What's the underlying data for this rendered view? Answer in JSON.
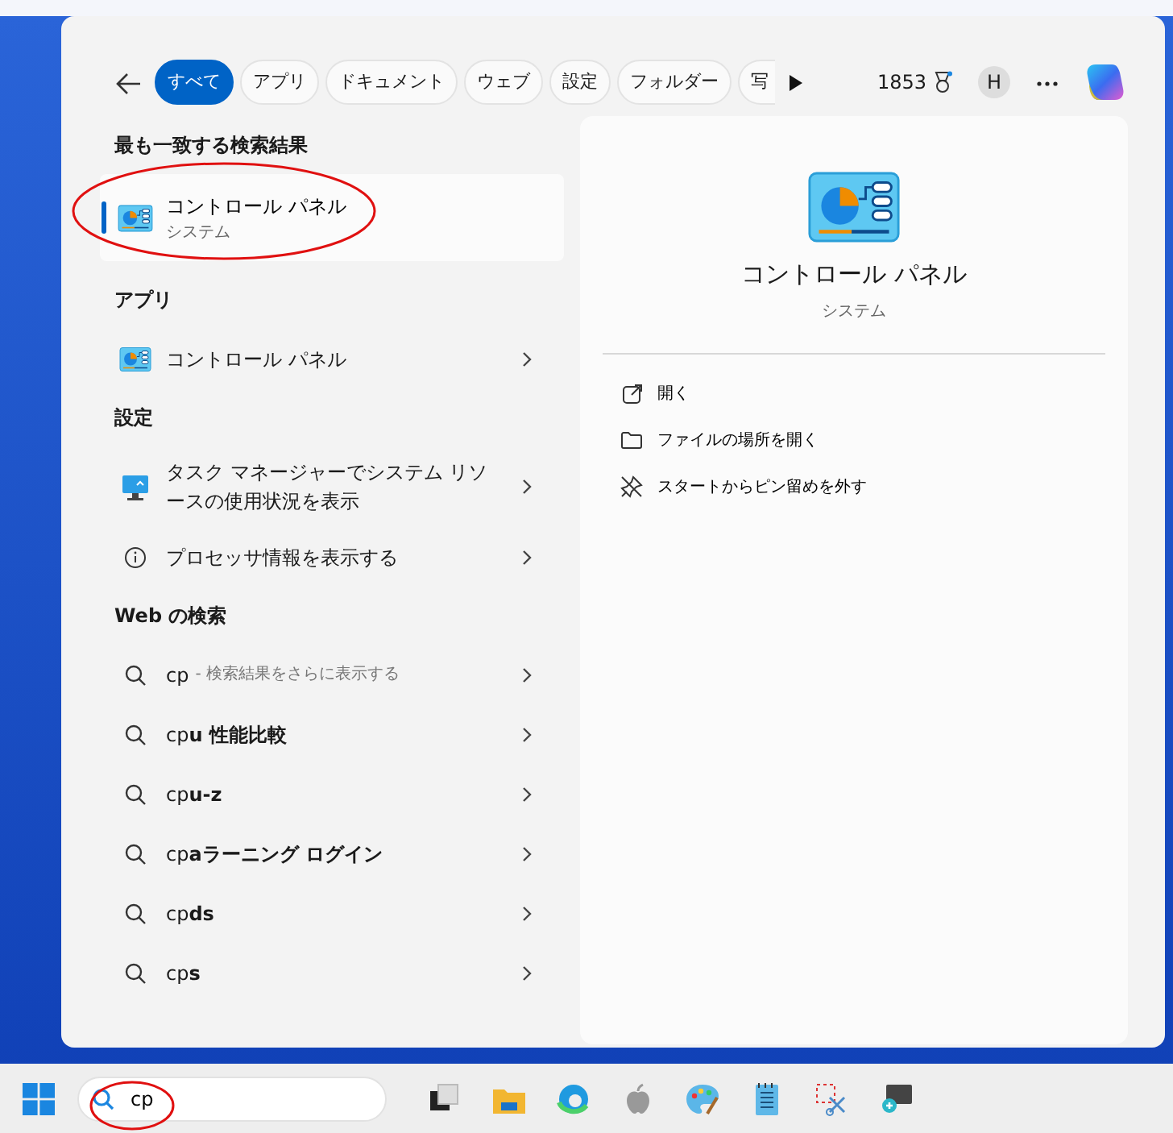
{
  "header": {
    "tabs": [
      {
        "label": "すべて",
        "selected": true
      },
      {
        "label": "アプリ",
        "selected": false
      },
      {
        "label": "ドキュメント",
        "selected": false
      },
      {
        "label": "ウェブ",
        "selected": false
      },
      {
        "label": "設定",
        "selected": false
      },
      {
        "label": "フォルダー",
        "selected": false
      },
      {
        "label": "写",
        "selected": false
      }
    ],
    "points": "1853",
    "avatar": "H"
  },
  "best_match": {
    "title": "最も一致する検索結果",
    "item": {
      "name": "コントロール パネル",
      "subtitle": "システム",
      "selected": true
    }
  },
  "sections": [
    {
      "title": "アプリ",
      "items": [
        {
          "kind": "app",
          "label": "コントロール パネル"
        }
      ]
    },
    {
      "title": "設定",
      "items": [
        {
          "kind": "monitor",
          "label": "タスク マネージャーでシステム リソースの使用状況を表示"
        },
        {
          "kind": "info",
          "label": "プロセッサ情報を表示する"
        }
      ]
    },
    {
      "title": "Web の検索",
      "items": [
        {
          "kind": "search",
          "label": "cp",
          "hint": "- 検索結果をさらに表示する"
        },
        {
          "kind": "search",
          "label": "cp**u 性能比較**"
        },
        {
          "kind": "search",
          "label": "cp**u-z**"
        },
        {
          "kind": "search",
          "label": "cp**aラーニング ログイン**"
        },
        {
          "kind": "search",
          "label": "cp**ds**"
        },
        {
          "kind": "search",
          "label": "cp**s**"
        }
      ]
    }
  ],
  "detail": {
    "title": "コントロール パネル",
    "subtitle": "システム",
    "actions": [
      {
        "kind": "open",
        "label": "開く"
      },
      {
        "kind": "folder",
        "label": "ファイルの場所を開く"
      },
      {
        "kind": "unpin",
        "label": "スタートからピン留めを外す"
      }
    ]
  },
  "taskbar": {
    "search": {
      "value": "cp"
    }
  }
}
